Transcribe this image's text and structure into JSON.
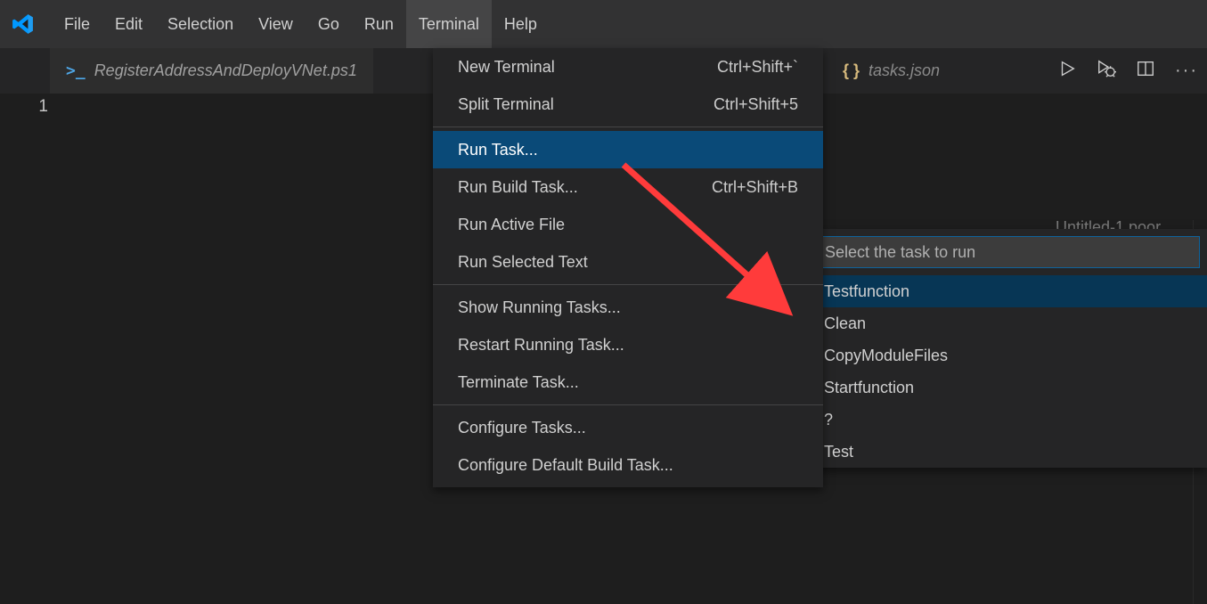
{
  "menubar": {
    "items": [
      "File",
      "Edit",
      "Selection",
      "View",
      "Go",
      "Run",
      "Terminal",
      "Help"
    ],
    "active_index": 6
  },
  "tabs": {
    "main_label": "RegisterAddressAndDeployVNet.ps1",
    "json_label": "tasks.json"
  },
  "editor": {
    "line_number": "1",
    "hint_text": "Untitled-1    poor"
  },
  "terminal_menu": {
    "groups": [
      [
        {
          "label": "New Terminal",
          "shortcut": "Ctrl+Shift+`"
        },
        {
          "label": "Split Terminal",
          "shortcut": "Ctrl+Shift+5"
        }
      ],
      [
        {
          "label": "Run Task...",
          "shortcut": "",
          "selected": true
        },
        {
          "label": "Run Build Task...",
          "shortcut": "Ctrl+Shift+B"
        },
        {
          "label": "Run Active File",
          "shortcut": ""
        },
        {
          "label": "Run Selected Text",
          "shortcut": ""
        }
      ],
      [
        {
          "label": "Show Running Tasks...",
          "shortcut": ""
        },
        {
          "label": "Restart Running Task...",
          "shortcut": ""
        },
        {
          "label": "Terminate Task...",
          "shortcut": ""
        }
      ],
      [
        {
          "label": "Configure Tasks...",
          "shortcut": ""
        },
        {
          "label": "Configure Default Build Task...",
          "shortcut": ""
        }
      ]
    ]
  },
  "quickpick": {
    "placeholder": "Select the task to run",
    "items": [
      "Testfunction",
      "Clean",
      "CopyModuleFiles",
      "Startfunction",
      "?",
      "Test"
    ],
    "selected_index": 0
  }
}
